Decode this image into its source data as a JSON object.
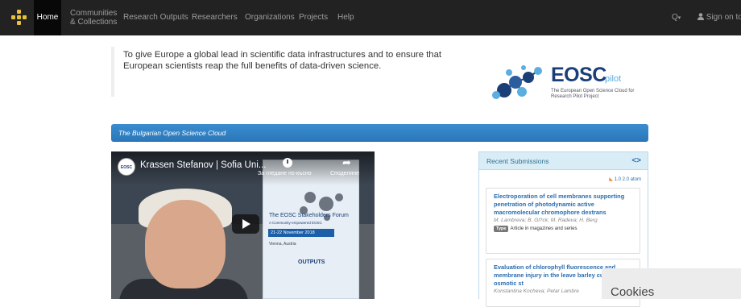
{
  "nav": {
    "home": "Home",
    "communities_line1": "Communities",
    "communities_line2": "& Collections",
    "research_outputs": "Research Outputs",
    "researchers": "Researchers",
    "organizations": "Organizations",
    "projects": "Projects",
    "help": "Help",
    "search_icon": "Q",
    "search_caret": "▾",
    "sign_on": "Sign on to:"
  },
  "intro": {
    "text": "To give Europe a global lead in scientific data infrastructures and to ensure that European scientists reap the full benefits of data-driven science."
  },
  "eosc_logo": {
    "title": "EOSC",
    "pilot": "pilot",
    "subtitle": "The European Open Science Cloud for Research Pilot Project"
  },
  "banner": {
    "text": "The Bulgarian Open Science Cloud"
  },
  "video": {
    "channel_avatar": "EOSC",
    "title": "Krassen Stefanov | Sofia Uni...",
    "watch_later": "За гледане по-късно",
    "share": "Споделяне",
    "poster_forum": "The EOSC Stakeholders Forum",
    "poster_forum_highlight": "EOSC",
    "poster_subtitle": "A Community-empowered EOSC",
    "poster_date": "21-22 November 2018",
    "poster_venue": "Vienna, Austria",
    "poster_outputs": "OUTPUTS"
  },
  "recent": {
    "heading": "Recent Submissions",
    "arrows": "<>",
    "feeds": "1.0  2.0  atom",
    "items": [
      {
        "title": "Electroporation of cell membranes supporting penetration of photodynamic active macromolecular chromophore dextrans",
        "authors": "M. Lambreva; B. Gl?ck; M. Radeva; H. Berg",
        "type_label": "Type",
        "type_value": "Article in magazines and series"
      },
      {
        "title": "Evaluation of chlorophyll fluorescence and membrane injury in the leave barley cultivars under osmotic st",
        "authors": "Konstantina Kocheva; Petar Lambre"
      }
    ]
  },
  "cookies": {
    "label": "Cookies"
  },
  "colors": {
    "navbar": "#222222",
    "banner": "#2a76b8",
    "link": "#2a6db0",
    "panel_heading": "#d9edf7",
    "logo_navy": "#1a3f78"
  },
  "icons": {
    "logo": "grid-dots-icon",
    "search": "search-icon",
    "user": "user-icon",
    "rss": "rss-icon",
    "play": "play-icon",
    "clock": "clock-icon",
    "share": "share-icon"
  }
}
